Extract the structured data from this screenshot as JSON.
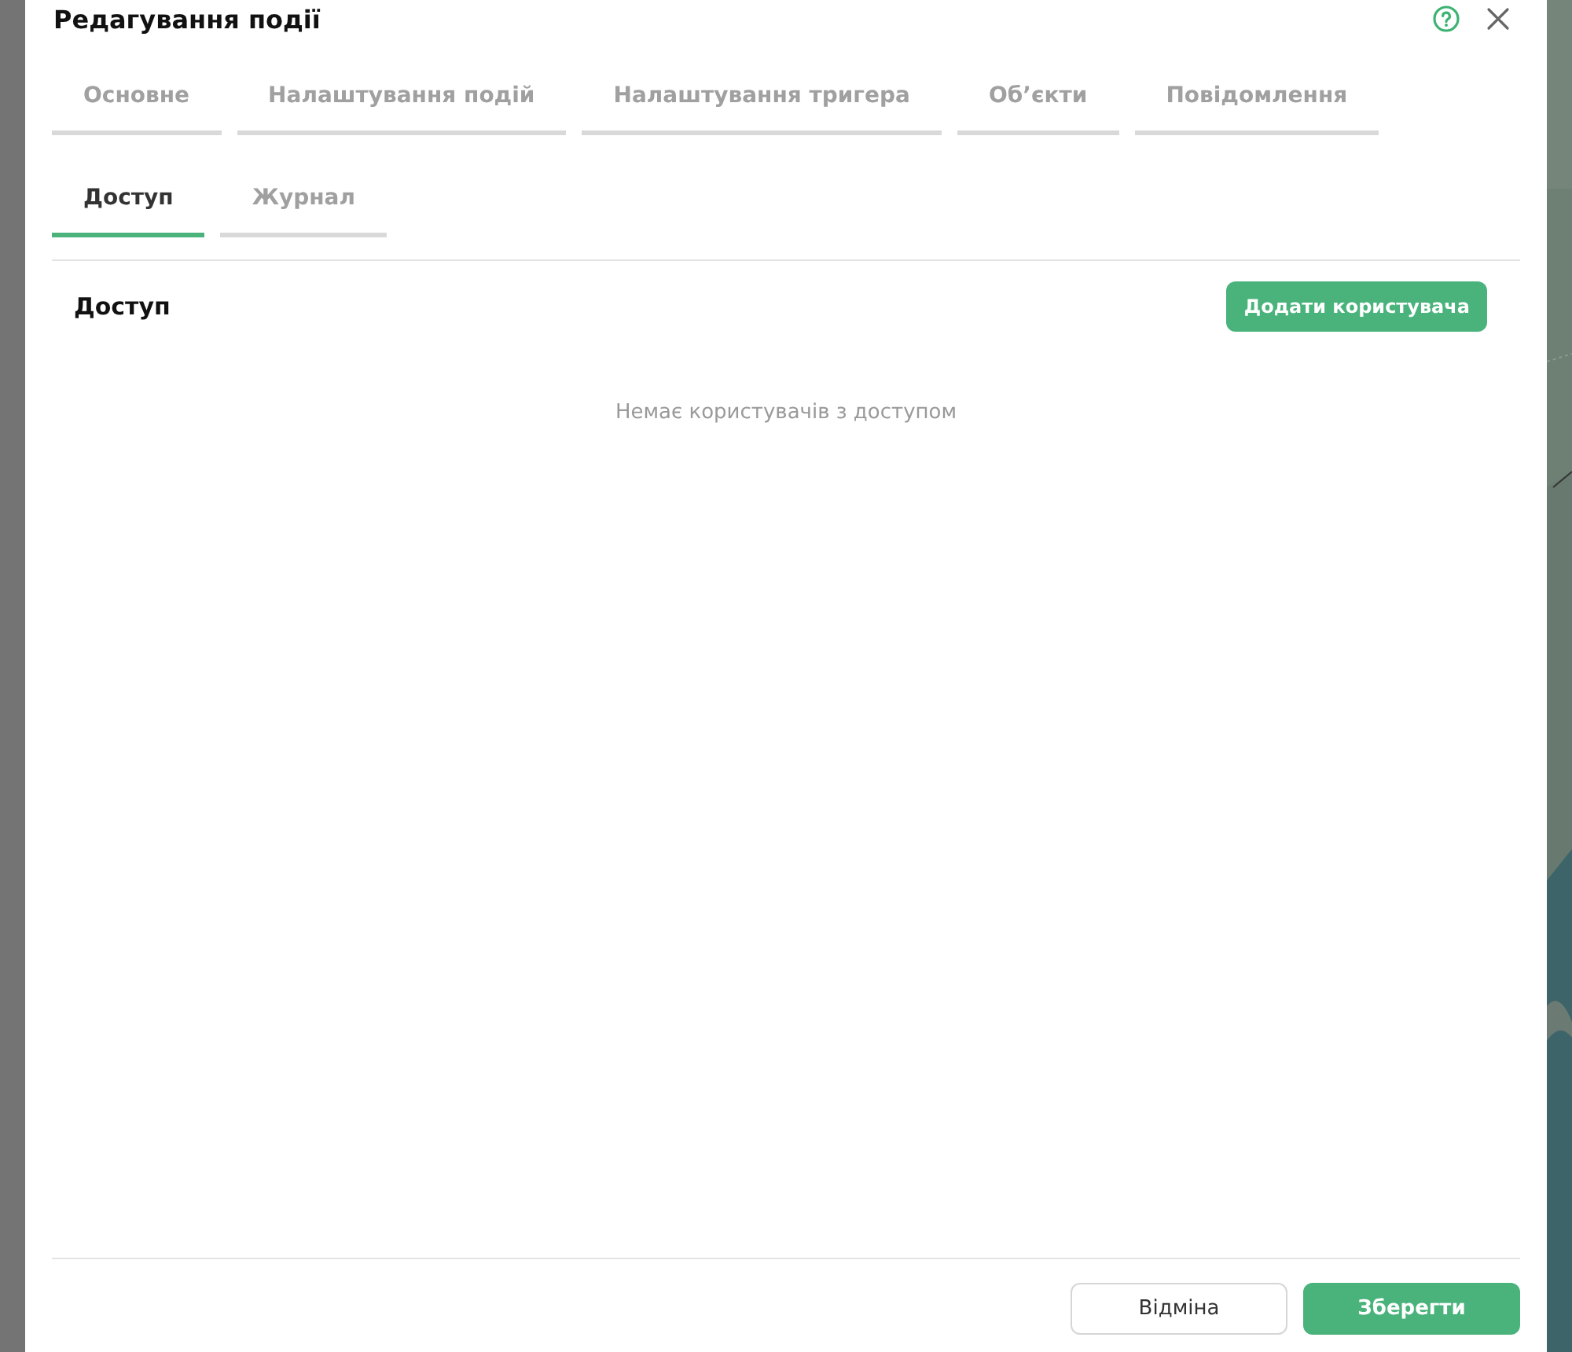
{
  "dialog": {
    "title": "Редагування події"
  },
  "tabs": [
    {
      "label": "Основне",
      "selected": false
    },
    {
      "label": "Налаштування подій",
      "selected": false
    },
    {
      "label": "Налаштування тригера",
      "selected": false
    },
    {
      "label": "Об’єкти",
      "selected": false
    },
    {
      "label": "Повідомлення",
      "selected": false
    },
    {
      "label": "Доступ",
      "selected": true
    },
    {
      "label": "Журнал",
      "selected": false
    }
  ],
  "section": {
    "title": "Доступ",
    "add_button": "Додати користувача",
    "empty_message": "Немає користувачів з доступом"
  },
  "footer": {
    "cancel": "Відміна",
    "save": "Зберегти"
  }
}
